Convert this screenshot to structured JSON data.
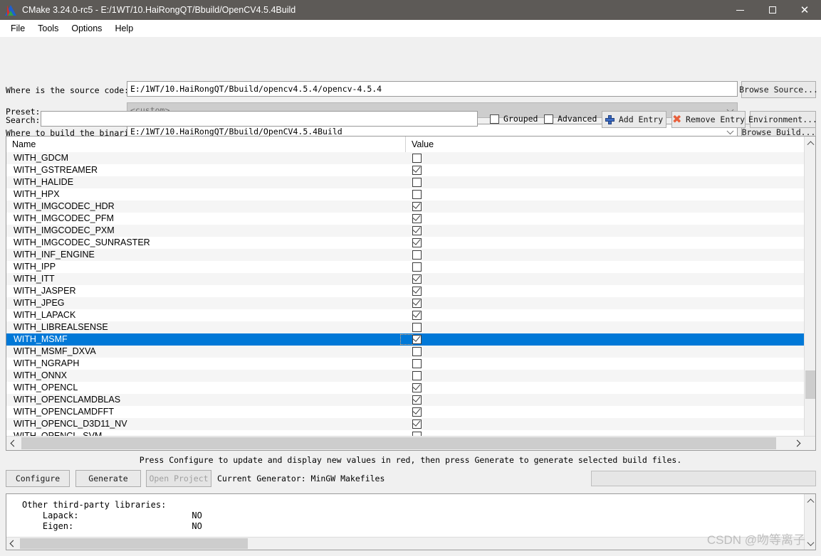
{
  "window": {
    "title": "CMake 3.24.0-rc5 - E:/1WT/10.HaiRongQT/Bbuild/OpenCV4.5.4Build",
    "icon": "cmake-logo-icon",
    "minimize_label": "—",
    "maximize_label": "□",
    "close_label": "✕"
  },
  "menu": {
    "items": [
      {
        "label": "File"
      },
      {
        "label": "Tools"
      },
      {
        "label": "Options"
      },
      {
        "label": "Help"
      }
    ]
  },
  "form": {
    "source_label": "Where is the source code:",
    "source_value": "E:/1WT/10.HaiRongQT/Bbuild/opencv4.5.4/opencv-4.5.4",
    "browse_source_label": "Browse Source...",
    "preset_label": "Preset:",
    "preset_value": "<custom>",
    "build_label": "Where to build the binaries:",
    "build_value": "E:/1WT/10.HaiRongQT/Bbuild/OpenCV4.5.4Build",
    "browse_build_label": "Browse Build...",
    "search_label": "Search:",
    "search_value": "",
    "grouped_label": "Grouped",
    "grouped_checked": false,
    "advanced_label": "Advanced",
    "advanced_checked": false,
    "add_entry_label": "Add Entry",
    "remove_entry_label": "Remove Entry",
    "environment_label": "Environment..."
  },
  "table": {
    "columns": [
      "Name",
      "Value"
    ],
    "rows": [
      {
        "name": "WITH_GDCM",
        "checked": false
      },
      {
        "name": "WITH_GSTREAMER",
        "checked": true
      },
      {
        "name": "WITH_HALIDE",
        "checked": false
      },
      {
        "name": "WITH_HPX",
        "checked": false
      },
      {
        "name": "WITH_IMGCODEC_HDR",
        "checked": true
      },
      {
        "name": "WITH_IMGCODEC_PFM",
        "checked": true
      },
      {
        "name": "WITH_IMGCODEC_PXM",
        "checked": true
      },
      {
        "name": "WITH_IMGCODEC_SUNRASTER",
        "checked": true
      },
      {
        "name": "WITH_INF_ENGINE",
        "checked": false
      },
      {
        "name": "WITH_IPP",
        "checked": false
      },
      {
        "name": "WITH_ITT",
        "checked": true
      },
      {
        "name": "WITH_JASPER",
        "checked": true
      },
      {
        "name": "WITH_JPEG",
        "checked": true
      },
      {
        "name": "WITH_LAPACK",
        "checked": true
      },
      {
        "name": "WITH_LIBREALSENSE",
        "checked": false
      },
      {
        "name": "WITH_MSMF",
        "checked": true,
        "selected": true
      },
      {
        "name": "WITH_MSMF_DXVA",
        "checked": false
      },
      {
        "name": "WITH_NGRAPH",
        "checked": false
      },
      {
        "name": "WITH_ONNX",
        "checked": false
      },
      {
        "name": "WITH_OPENCL",
        "checked": true
      },
      {
        "name": "WITH_OPENCLAMDBLAS",
        "checked": true
      },
      {
        "name": "WITH_OPENCLAMDFFT",
        "checked": true
      },
      {
        "name": "WITH_OPENCL_D3D11_NV",
        "checked": true
      },
      {
        "name": "WITH_OPENCL_SVM",
        "checked": false
      }
    ]
  },
  "annotation": {
    "color": "#f40f02",
    "highlighted_rows": [
      "WITH_LIBREALSENSE",
      "WITH_MSMF",
      "WITH_MSMF_DXVA"
    ]
  },
  "status": {
    "message": "Press Configure to update and display new values in red, then press Generate to generate selected build files.",
    "configure_label": "Configure",
    "generate_label": "Generate",
    "open_project_label": "Open Project",
    "generator_text": "Current Generator: MinGW Makefiles"
  },
  "log": {
    "lines": [
      "Other third-party libraries:",
      "    Lapack:                      NO",
      "    Eigen:                       NO"
    ]
  },
  "watermark": "CSDN @吻等离子",
  "colors": {
    "titlebar": "#5d5a57",
    "selection": "#0078d7",
    "annotation": "#f40f02",
    "window_bg": "#f0f0f0"
  }
}
